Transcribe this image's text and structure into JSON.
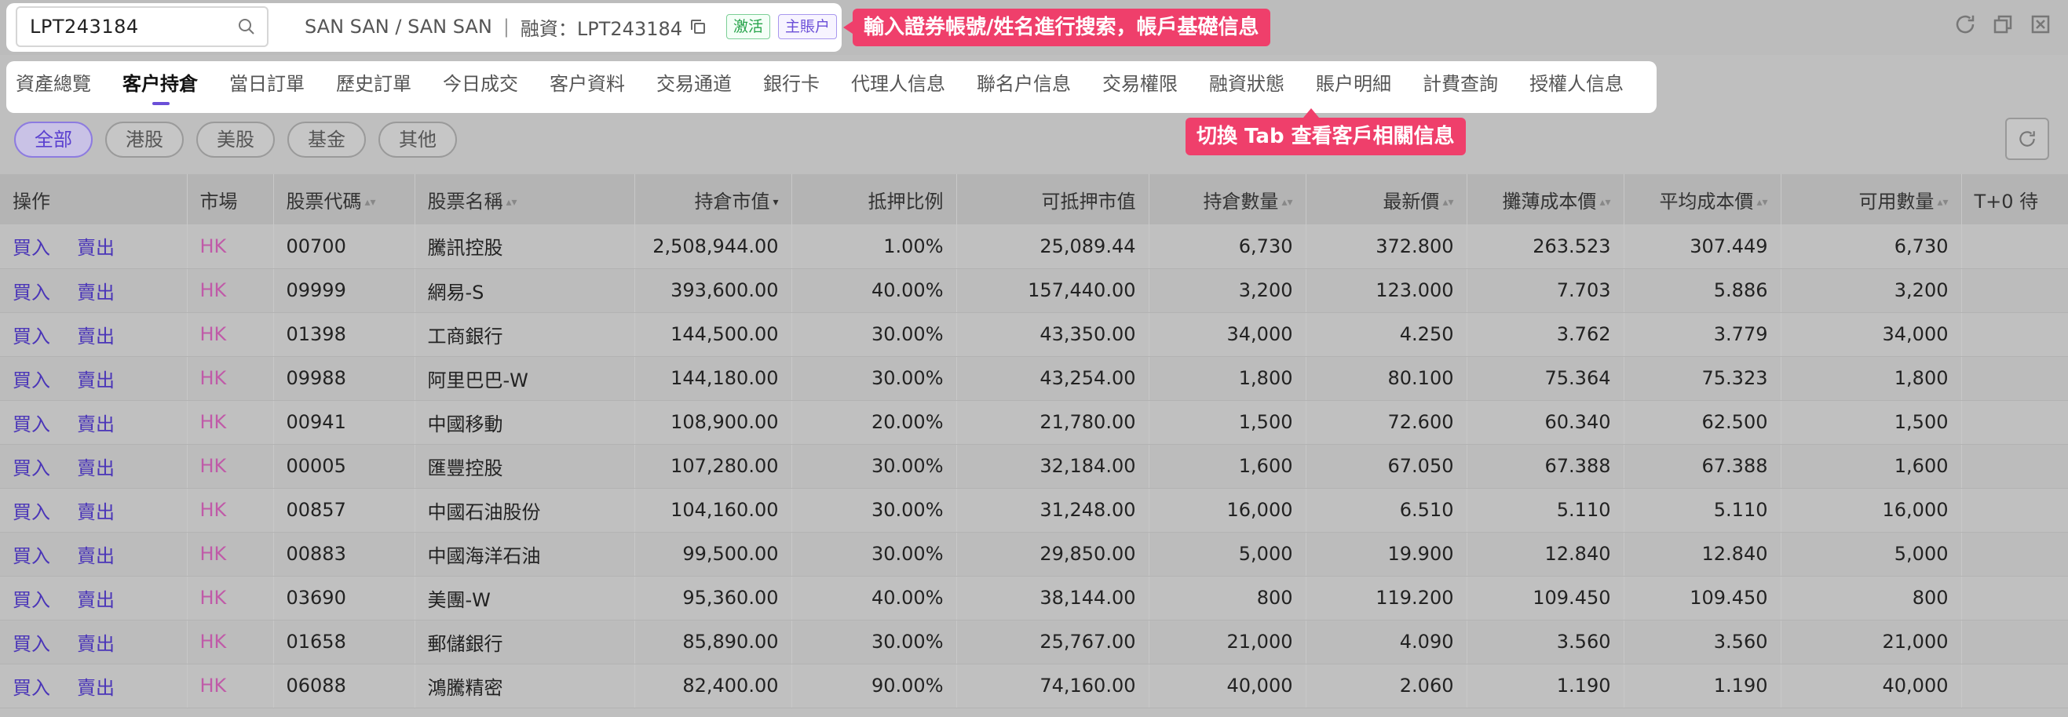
{
  "search": {
    "value": "LPT243184"
  },
  "account": {
    "name": "SAN SAN / SAN SAN",
    "type_label": "融資：LPT243184",
    "badge_active": "激活",
    "badge_main": "主賬户"
  },
  "tooltips": {
    "search_tip": "輸入證券帳號/姓名進行搜索，帳戶基礎信息",
    "tab_tip": "切換 Tab 查看客戶相關信息"
  },
  "tabs": [
    {
      "label": "資產總覽"
    },
    {
      "label": "客户持倉"
    },
    {
      "label": "當日訂單"
    },
    {
      "label": "歷史訂單"
    },
    {
      "label": "今日成交"
    },
    {
      "label": "客户資料"
    },
    {
      "label": "交易通道"
    },
    {
      "label": "銀行卡"
    },
    {
      "label": "代理人信息"
    },
    {
      "label": "聯名户信息"
    },
    {
      "label": "交易權限"
    },
    {
      "label": "融資狀態"
    },
    {
      "label": "賬户明細"
    },
    {
      "label": "計費查詢"
    },
    {
      "label": "授權人信息"
    }
  ],
  "active_tab": "客户持倉",
  "filters": [
    {
      "label": "全部"
    },
    {
      "label": "港股"
    },
    {
      "label": "美股"
    },
    {
      "label": "基金"
    },
    {
      "label": "其他"
    }
  ],
  "columns": [
    "操作",
    "市場",
    "股票代碼",
    "股票名稱",
    "持倉市值",
    "抵押比例",
    "可抵押市值",
    "持倉數量",
    "最新價",
    "攤薄成本價",
    "平均成本價",
    "可用數量",
    "T+0 待"
  ],
  "actions": {
    "buy": "買入",
    "sell": "賣出"
  },
  "rows": [
    {
      "market": "HK",
      "code": "00700",
      "name": "騰訊控股",
      "mv": "2,508,944.00",
      "ratio": "1.00%",
      "pmv": "25,089.44",
      "qty": "6,730",
      "price": "372.800",
      "dcost": "263.523",
      "acost": "307.449",
      "avail": "6,730"
    },
    {
      "market": "HK",
      "code": "09999",
      "name": "網易-S",
      "mv": "393,600.00",
      "ratio": "40.00%",
      "pmv": "157,440.00",
      "qty": "3,200",
      "price": "123.000",
      "dcost": "7.703",
      "acost": "5.886",
      "avail": "3,200"
    },
    {
      "market": "HK",
      "code": "01398",
      "name": "工商銀行",
      "mv": "144,500.00",
      "ratio": "30.00%",
      "pmv": "43,350.00",
      "qty": "34,000",
      "price": "4.250",
      "dcost": "3.762",
      "acost": "3.779",
      "avail": "34,000"
    },
    {
      "market": "HK",
      "code": "09988",
      "name": "阿里巴巴-W",
      "mv": "144,180.00",
      "ratio": "30.00%",
      "pmv": "43,254.00",
      "qty": "1,800",
      "price": "80.100",
      "dcost": "75.364",
      "acost": "75.323",
      "avail": "1,800"
    },
    {
      "market": "HK",
      "code": "00941",
      "name": "中國移動",
      "mv": "108,900.00",
      "ratio": "20.00%",
      "pmv": "21,780.00",
      "qty": "1,500",
      "price": "72.600",
      "dcost": "60.340",
      "acost": "62.500",
      "avail": "1,500"
    },
    {
      "market": "HK",
      "code": "00005",
      "name": "匯豐控股",
      "mv": "107,280.00",
      "ratio": "30.00%",
      "pmv": "32,184.00",
      "qty": "1,600",
      "price": "67.050",
      "dcost": "67.388",
      "acost": "67.388",
      "avail": "1,600"
    },
    {
      "market": "HK",
      "code": "00857",
      "name": "中國石油股份",
      "mv": "104,160.00",
      "ratio": "30.00%",
      "pmv": "31,248.00",
      "qty": "16,000",
      "price": "6.510",
      "dcost": "5.110",
      "acost": "5.110",
      "avail": "16,000"
    },
    {
      "market": "HK",
      "code": "00883",
      "name": "中國海洋石油",
      "mv": "99,500.00",
      "ratio": "30.00%",
      "pmv": "29,850.00",
      "qty": "5,000",
      "price": "19.900",
      "dcost": "12.840",
      "acost": "12.840",
      "avail": "5,000"
    },
    {
      "market": "HK",
      "code": "03690",
      "name": "美團-W",
      "mv": "95,360.00",
      "ratio": "40.00%",
      "pmv": "38,144.00",
      "qty": "800",
      "price": "119.200",
      "dcost": "109.450",
      "acost": "109.450",
      "avail": "800"
    },
    {
      "market": "HK",
      "code": "01658",
      "name": "郵儲銀行",
      "mv": "85,890.00",
      "ratio": "30.00%",
      "pmv": "25,767.00",
      "qty": "21,000",
      "price": "4.090",
      "dcost": "3.560",
      "acost": "3.560",
      "avail": "21,000"
    },
    {
      "market": "HK",
      "code": "06088",
      "name": "鴻騰精密",
      "mv": "82,400.00",
      "ratio": "90.00%",
      "pmv": "74,160.00",
      "qty": "40,000",
      "price": "2.060",
      "dcost": "1.190",
      "acost": "1.190",
      "avail": "40,000"
    }
  ],
  "colors": {
    "accent": "#6b4fd8",
    "tip": "#ef3f6b",
    "market": "#c05aa8"
  },
  "icons": [
    "search-icon",
    "copy-icon",
    "refresh-icon",
    "window-icon",
    "close-window-icon",
    "sort-icon"
  ]
}
